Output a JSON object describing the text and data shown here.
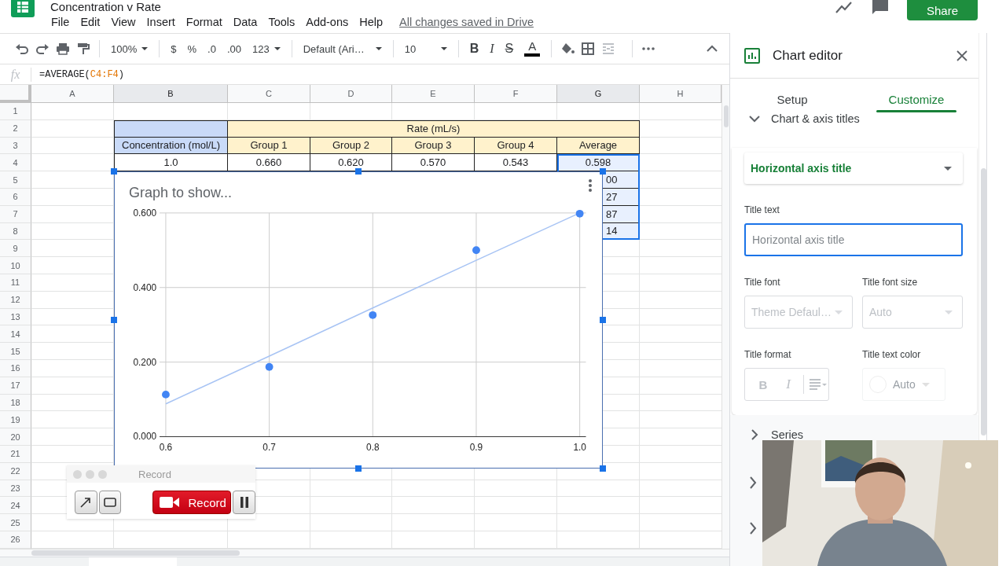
{
  "app": {
    "title": "Concentration v Rate",
    "menus": [
      "File",
      "Edit",
      "View",
      "Insert",
      "Format",
      "Data",
      "Tools",
      "Add-ons",
      "Help"
    ],
    "save_status": "All changes saved in Drive",
    "share": "Share"
  },
  "toolbar": {
    "zoom": "100%",
    "currency": "$",
    "percent": "%",
    "decimal_less": ".0",
    "decimal_more": ".00",
    "number_format": "123",
    "font": "Default (Ari…",
    "font_size": "10",
    "bold": "B",
    "italic": "I",
    "strike": "S",
    "text_color": "A"
  },
  "formula": {
    "label": "fx",
    "prefix": "=AVERAGE(",
    "ref": "C4:F4",
    "suffix": ")"
  },
  "sheet": {
    "columns": [
      {
        "label": "A",
        "selected": false
      },
      {
        "label": "B",
        "selected": true
      },
      {
        "label": "C",
        "selected": false
      },
      {
        "label": "D",
        "selected": false
      },
      {
        "label": "E",
        "selected": false
      },
      {
        "label": "F",
        "selected": false
      },
      {
        "label": "G",
        "selected": true
      },
      {
        "label": "H",
        "selected": false
      }
    ],
    "rows": [
      "1",
      "2",
      "3",
      "4",
      "5",
      "6",
      "7",
      "8",
      "9",
      "10",
      "11",
      "12",
      "13",
      "14",
      "15",
      "16",
      "17",
      "18",
      "19",
      "20",
      "21",
      "22",
      "23",
      "24",
      "25",
      "26"
    ]
  },
  "table": {
    "group_label": "Rate (mL/s)",
    "columns": [
      "Concentration (mol/L)",
      "Group 1",
      "Group 2",
      "Group 3",
      "Group 4",
      "Average"
    ],
    "rows": [
      [
        "1.0",
        "0.660",
        "0.620",
        "0.570",
        "0.543",
        "0.598"
      ]
    ],
    "average_fragments": [
      "00",
      "27",
      "87",
      "14"
    ]
  },
  "chart": {
    "chart_data": {
      "type": "scatter",
      "title": "Graph to show...",
      "x": [
        0.6,
        0.7,
        0.8,
        0.9,
        1.0
      ],
      "series": [
        {
          "color": "#4285f4",
          "values": [
            0.113,
            0.187,
            0.326,
            0.5,
            0.598
          ]
        },
        {
          "type": "line",
          "color": "#a8c4f4",
          "values": [
            0.088,
            0.216,
            0.345,
            0.473,
            0.6
          ]
        }
      ],
      "grid": true,
      "xlim": [
        0.6,
        1.0
      ],
      "ylim": [
        0,
        0.6
      ],
      "xticks": [
        {
          "value": 0.6,
          "label": "0.6"
        },
        {
          "value": 0.7,
          "label": "0.7"
        },
        {
          "value": 0.8,
          "label": "0.8"
        },
        {
          "value": 0.9,
          "label": "0.9"
        },
        {
          "value": 1.0,
          "label": "1.0"
        }
      ],
      "yticks": [
        {
          "value": 0,
          "label": "0.000"
        },
        {
          "value": 0.2,
          "label": "0.200"
        },
        {
          "value": 0.4,
          "label": "0.400"
        },
        {
          "value": 0.6,
          "label": "0.600"
        }
      ]
    }
  },
  "recorder": {
    "title": "Record",
    "record_label": "Record"
  },
  "editor": {
    "title": "Chart editor",
    "tabs": [
      {
        "label": "Setup",
        "selected": false
      },
      {
        "label": "Customize",
        "selected": true
      }
    ],
    "section": {
      "label": "Chart & axis titles",
      "expanded": true
    },
    "title_select": "Horizontal axis title",
    "title_text": {
      "label": "Title text",
      "placeholder": "Horizontal axis title",
      "focused": true
    },
    "font": {
      "label": "Title font",
      "value": "Theme Defaul…",
      "disabled": true
    },
    "font_size": {
      "label": "Title font size",
      "value": "Auto",
      "disabled": true
    },
    "format": {
      "label": "Title format",
      "bold": "B",
      "italic": "I"
    },
    "text_color": {
      "label": "Title text color",
      "value": "Auto",
      "disabled": true
    },
    "collapsed_sections": [
      {
        "label": "Series",
        "expanded": false
      }
    ]
  }
}
